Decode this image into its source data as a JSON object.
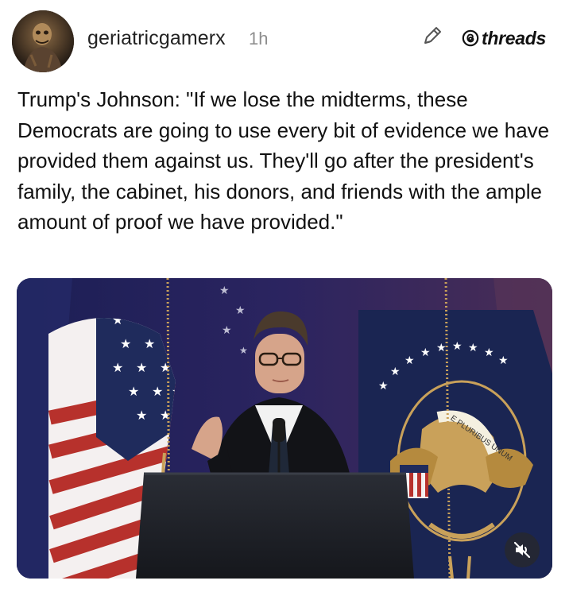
{
  "post": {
    "username": "geriatricgamerx",
    "timestamp": "1h",
    "text": "Trump's Johnson: \"If we lose the midterms, these Democrats are going to use every bit of evidence we have provided them against us. They'll go after the president's family, the cabinet, his donors, and friends with the ample amount of proof we have provided.\""
  },
  "brand": {
    "label": "threads"
  },
  "icons": {
    "avatar": "avatar-image",
    "edit": "pencil-icon",
    "threads_logo": "threads-logo-icon",
    "mute": "muted-speaker-icon"
  },
  "media": {
    "seal_text": "E PLURIBUS UNUM",
    "colors": {
      "background": "#1f1f4a",
      "flag_red": "#b7312c",
      "flag_blue": "#1f2b5c",
      "gold": "#c9a15a"
    }
  }
}
